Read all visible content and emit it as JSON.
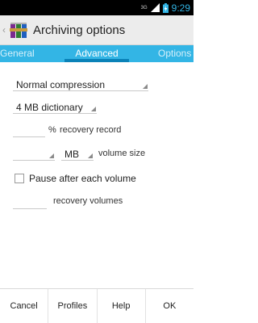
{
  "status_bar": {
    "network": "3G",
    "time": "9:29"
  },
  "action_bar": {
    "title": "Archiving options",
    "up_glyph": "‹",
    "logo_icon": "winrar-books-icon"
  },
  "tabs": [
    {
      "label": "General"
    },
    {
      "label": "Advanced",
      "selected": true
    },
    {
      "label": "Options"
    }
  ],
  "compression": {
    "value": "Normal compression"
  },
  "dictionary": {
    "value": "4 MB dictionary"
  },
  "recovery_record": {
    "value": "",
    "unit": "%",
    "label": "recovery record"
  },
  "volume_size": {
    "value": "",
    "unit": "MB",
    "label": "volume size"
  },
  "pause_after_volume": {
    "label": "Pause after each volume",
    "checked": false
  },
  "recovery_volumes": {
    "value": "",
    "label": "recovery volumes"
  },
  "buttons": {
    "cancel": "Cancel",
    "profiles": "Profiles",
    "help": "Help",
    "ok": "OK"
  },
  "colors": {
    "accent": "#33b5e5",
    "tab_indicator": "#0a82b8",
    "time": "#33b5e5"
  }
}
